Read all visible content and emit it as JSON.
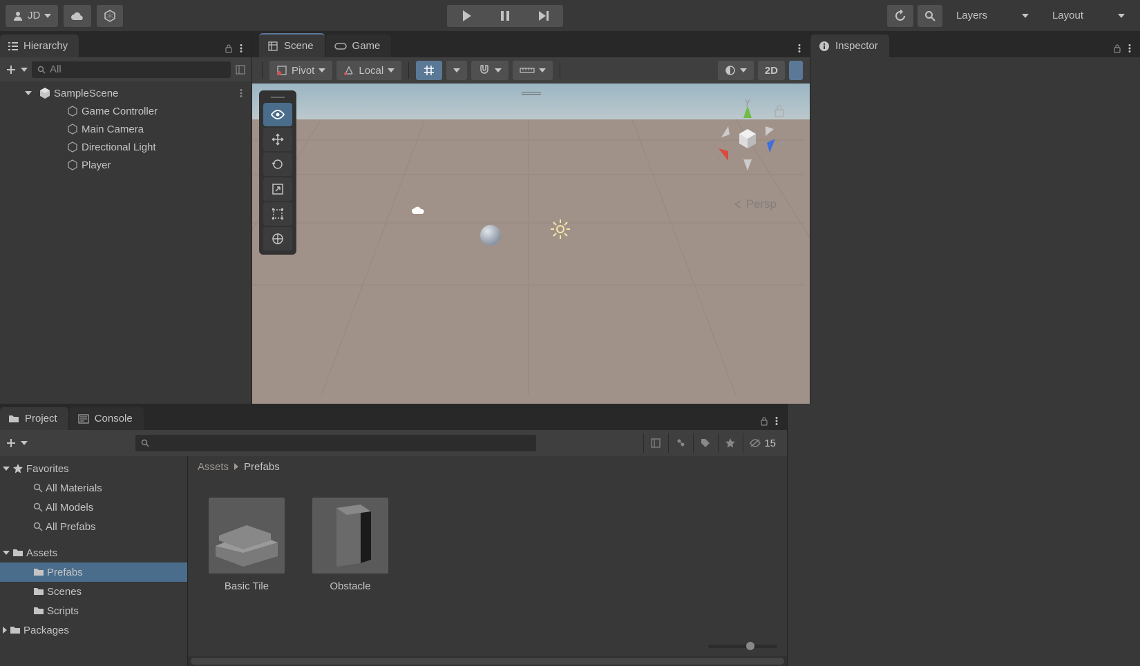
{
  "topbar": {
    "username": "JD",
    "layers_label": "Layers",
    "layout_label": "Layout"
  },
  "hierarchy": {
    "tab_label": "Hierarchy",
    "search_placeholder": "All",
    "scene_name": "SampleScene",
    "items": [
      {
        "label": "Game Controller"
      },
      {
        "label": "Main Camera"
      },
      {
        "label": "Directional Light"
      },
      {
        "label": "Player"
      }
    ]
  },
  "scene": {
    "tab_scene": "Scene",
    "tab_game": "Game",
    "pivot_label": "Pivot",
    "local_label": "Local",
    "mode_2d": "2D",
    "persp_label": "Persp",
    "axis_x": "x",
    "axis_y": "y",
    "axis_z": "z"
  },
  "inspector": {
    "tab_label": "Inspector"
  },
  "project": {
    "tab_project": "Project",
    "tab_console": "Console",
    "hidden_count": "15",
    "favorites_label": "Favorites",
    "favorites": [
      {
        "label": "All Materials"
      },
      {
        "label": "All Models"
      },
      {
        "label": "All Prefabs"
      }
    ],
    "assets_label": "Assets",
    "asset_folders": [
      {
        "label": "Prefabs",
        "selected": true
      },
      {
        "label": "Scenes",
        "selected": false
      },
      {
        "label": "Scripts",
        "selected": false
      }
    ],
    "packages_label": "Packages",
    "breadcrumb": [
      "Assets",
      "Prefabs"
    ],
    "items": [
      {
        "label": "Basic Tile"
      },
      {
        "label": "Obstacle"
      }
    ]
  }
}
